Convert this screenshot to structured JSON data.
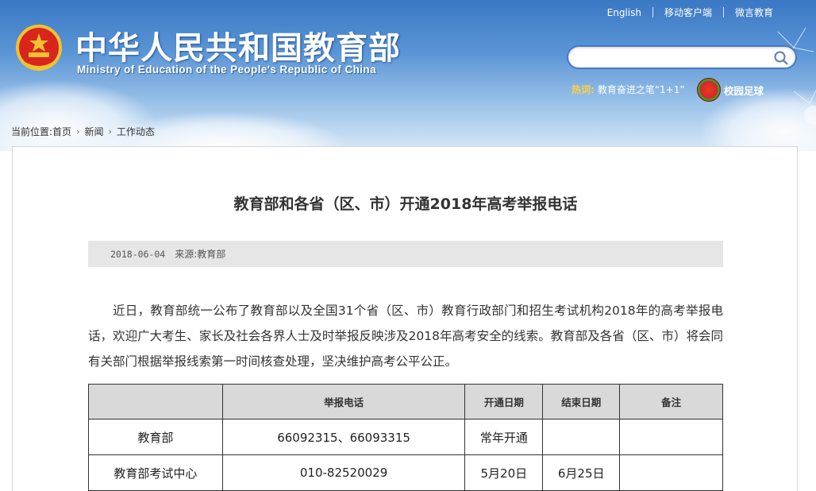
{
  "header": {
    "top_links": [
      "English",
      "移动客户端",
      "微言教育"
    ],
    "site_title": "中华人民共和国教育部",
    "site_subtitle": "Ministry of Education of the People's Republic of China",
    "search": {
      "placeholder": "",
      "value": ""
    },
    "hot_label": "热词:",
    "hot_text": "教育奋进之笔“1+1”",
    "football_label": "校园足球"
  },
  "breadcrumb": {
    "prefix": "当前位置:",
    "items": [
      "首页",
      "新闻",
      "工作动态"
    ]
  },
  "article": {
    "title": "教育部和各省（区、市）开通2018年高考举报电话",
    "date": "2018-06-04",
    "source": "来源:教育部",
    "paragraph": "近日，教育部统一公布了教育部以及全国31个省（区、市）教育行政部门和招生考试机构2018年的高考举报电话，欢迎广大考生、家长及社会各界人士及时举报反映涉及2018年高考安全的线索。教育部及各省（区、市）将会同有关部门根据举报线索第一时间核查处理，坚决维护高考公平公正。"
  },
  "table": {
    "headers": [
      "",
      "举报电话",
      "开通日期",
      "结束日期",
      "备注"
    ],
    "rows": [
      [
        "教育部",
        "66092315、66093315",
        "常年开通",
        "",
        ""
      ],
      [
        "教育部考试中心",
        "010-82520029",
        "5月20日",
        "6月25日",
        ""
      ]
    ]
  },
  "colors": {
    "sky_top": "#3b78c4",
    "hot_label": "#ffd04a",
    "table_header_bg": "#d9d9d9",
    "meta_bar_bg": "#e6e6e6"
  }
}
